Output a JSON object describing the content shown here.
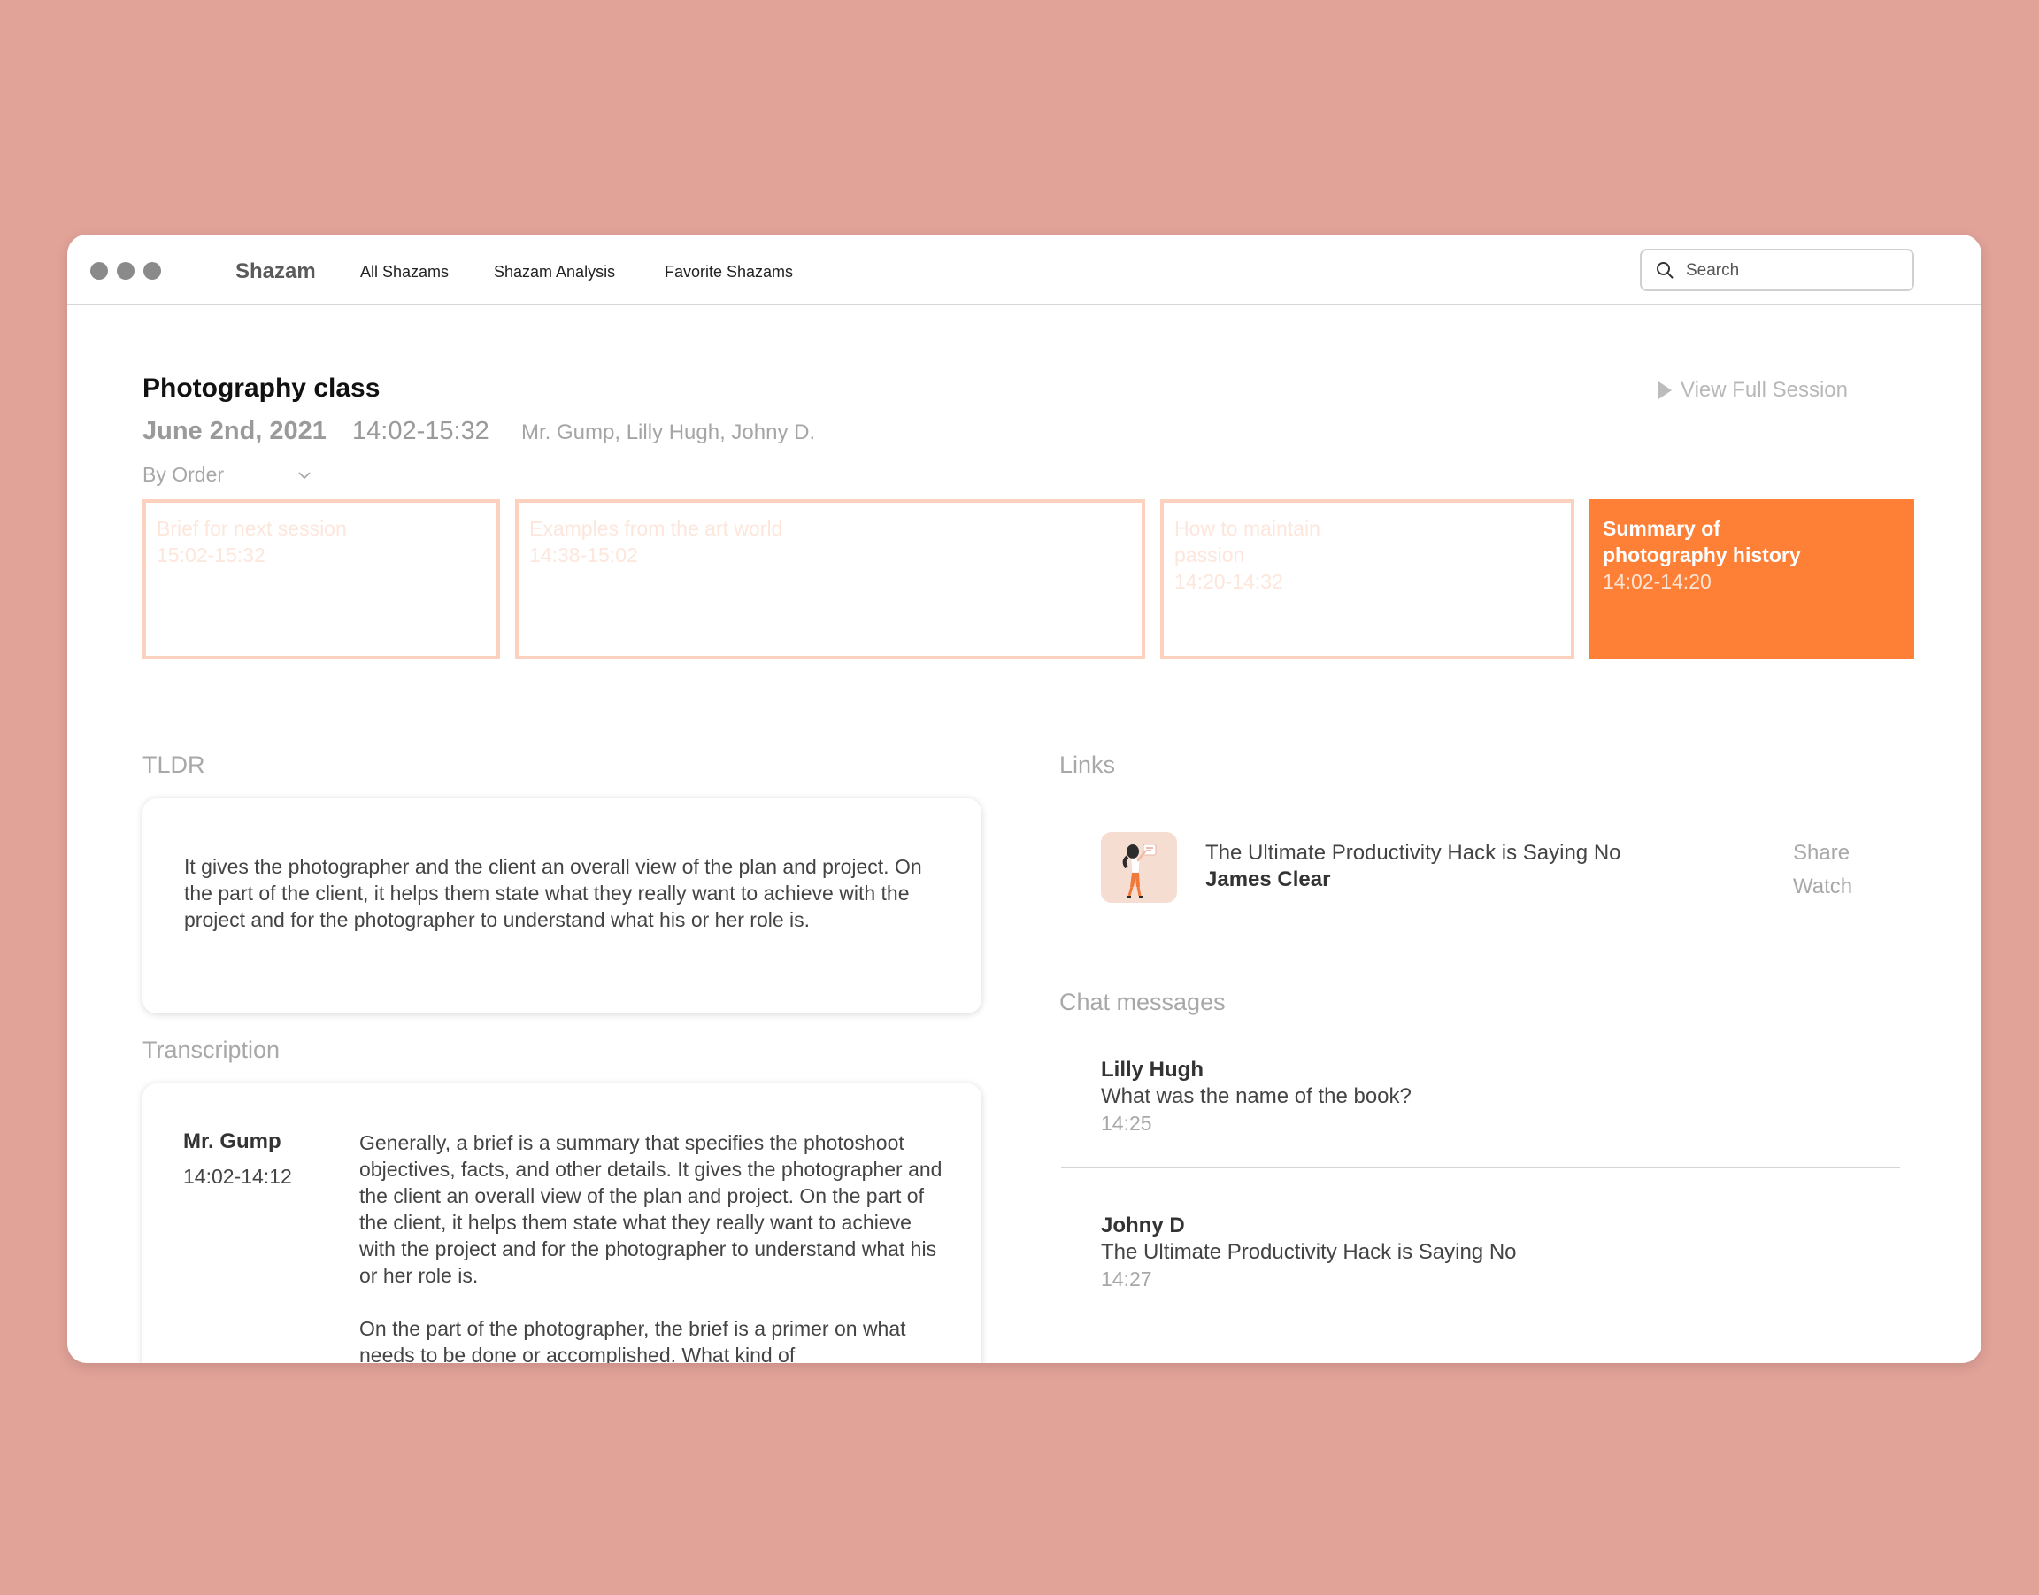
{
  "app": {
    "name": "Shazam",
    "nav": [
      "All Shazams",
      "Shazam Analysis",
      "Favorite Shazams"
    ],
    "search_placeholder": "Search"
  },
  "session": {
    "title": "Photography class",
    "date": "June 2nd, 2021",
    "time": "14:02-15:32",
    "participants": "Mr. Gump, Lilly Hugh, Johny D.",
    "view_full": "View Full Session",
    "sort": "By Order"
  },
  "segments": [
    {
      "title": "Brief for next session",
      "time": "15:02-15:32",
      "active": false
    },
    {
      "title": "Examples from the art world",
      "time": "14:38-15:02",
      "active": false
    },
    {
      "title": "How to maintain passion",
      "time": "14:20-14:32",
      "active": false
    },
    {
      "title": "Summary of photography history",
      "time": "14:02-14:20",
      "active": true
    }
  ],
  "tldr": {
    "label": "TLDR",
    "text": "It gives the photographer and the client an overall view of the plan and project. On the part of the client, it helps them state what they really want to achieve with the project and for the photographer to understand what his or her role is."
  },
  "transcription": {
    "label": "Transcription",
    "speaker": "Mr. Gump",
    "time": "14:02-14:12",
    "paragraphs": [
      "Generally, a brief is a summary that specifies the photoshoot objectives, facts, and other details. It gives the photographer and the client an overall view of the plan and project. On the part of the client, it helps them state what they really want to achieve with the project and for the photographer to understand what his or her role is.",
      "On the part of the photographer, the brief is a primer on what needs to be done or accomplished. What kind of"
    ]
  },
  "links": {
    "label": "Links",
    "items": [
      {
        "title": "The Ultimate Productivity Hack is Saying No",
        "author": "James Clear",
        "share": "Share",
        "watch": "Watch",
        "thumb_icon": "person-saying-no-illustration"
      }
    ]
  },
  "chat": {
    "label": "Chat messages",
    "messages": [
      {
        "author": "Lilly Hugh",
        "text": "What was the name of the book?",
        "time": "14:25"
      },
      {
        "author": "Johny D",
        "text": "The Ultimate Productivity Hack is Saying No",
        "time": "14:27"
      }
    ]
  },
  "colors": {
    "background": "#e1a298",
    "accent": "#fe7f36",
    "segment_border": "#fcd1bd"
  }
}
